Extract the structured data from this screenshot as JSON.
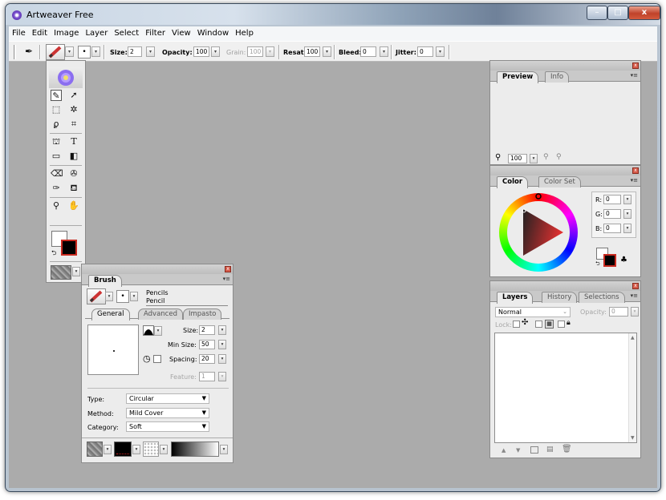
{
  "window": {
    "title": "Artweaver Free",
    "minimize": "–",
    "maximize": "□",
    "close": "x"
  },
  "menu": [
    "File",
    "Edit",
    "Image",
    "Layer",
    "Select",
    "Filter",
    "View",
    "Window",
    "Help"
  ],
  "toolbar": {
    "size_label": "Size:",
    "size_value": "2",
    "opacity_label": "Opacity:",
    "opacity_value": "100",
    "grain_label": "Grain:",
    "grain_value": "100",
    "resat_label": "Resat:",
    "resat_value": "100",
    "bleed_label": "Bleed:",
    "bleed_value": "0",
    "jitter_label": "Jitter:",
    "jitter_value": "0"
  },
  "preview_panel": {
    "tabs": [
      "Preview",
      "Info"
    ],
    "zoom_value": "100"
  },
  "color_panel": {
    "tabs": [
      "Color",
      "Color Set"
    ],
    "r_label": "R:",
    "r_value": "0",
    "g_label": "G:",
    "g_value": "0",
    "b_label": "B:",
    "b_value": "0"
  },
  "layers_panel": {
    "tabs": [
      "Layers",
      "History",
      "Selections"
    ],
    "blend_mode": "Normal",
    "opacity_label": "Opacity:",
    "opacity_value": "0",
    "lock_label": "Lock:"
  },
  "brush_panel": {
    "title": "Brush",
    "category_name": "Pencils",
    "variant_name": "Pencil",
    "tabs": [
      "General",
      "Advanced",
      "Impasto"
    ],
    "size_label": "Size:",
    "size_value": "2",
    "min_size_label": "Min Size:",
    "min_size_value": "50",
    "spacing_label": "Spacing:",
    "spacing_value": "20",
    "feature_label": "Feature:",
    "feature_value": "1",
    "type_label": "Type:",
    "type_value": "Circular",
    "method_label": "Method:",
    "method_value": "Mild Cover",
    "category_label": "Category:",
    "category_value": "Soft"
  },
  "toolbox": {
    "tools": [
      "brush-tool",
      "move-tool",
      "rect-select-tool",
      "magic-wand-tool",
      "lasso-tool",
      "crop-tool",
      "perspective-tool",
      "text-tool",
      "rectangle-tool",
      "gradient-tool",
      "eraser-tool",
      "clone-tool",
      "eyedropper-tool",
      "fill-tool",
      "zoom-tool",
      "hand-tool"
    ],
    "foreground_color": "#000000",
    "background_color": "#ffffff"
  }
}
